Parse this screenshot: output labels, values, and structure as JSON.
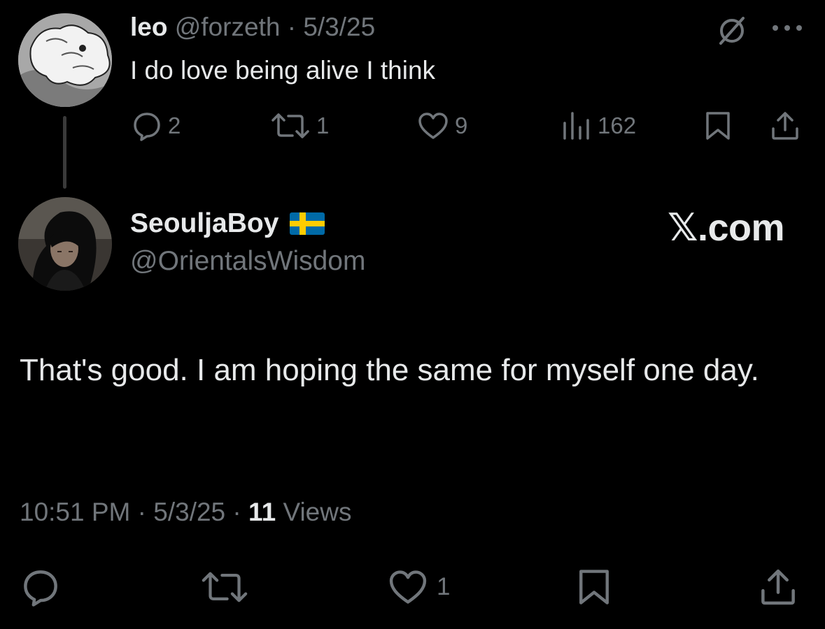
{
  "parent_tweet": {
    "name": "leo",
    "handle": "@forzeth",
    "separator": "·",
    "date": "5/3/25",
    "text": "I do love being alive I think",
    "actions": {
      "replies": "2",
      "reposts": "1",
      "likes": "9",
      "views": "162"
    }
  },
  "main_tweet": {
    "name": "SeouljaBoy",
    "flag": "sweden-flag",
    "handle": "@OrientalsWisdom",
    "text": "That's good. I am hoping the same for myself one day.",
    "time": "10:51 PM",
    "separator": "·",
    "date": "5/3/25",
    "views_count": "11",
    "views_label": "Views",
    "actions": {
      "likes": "1"
    }
  },
  "watermark": "𝕏.com",
  "colors": {
    "background": "#000000",
    "primary_text": "#e7e9ea",
    "secondary_text": "#71767b",
    "thread_line": "#3a3a3a",
    "flag_blue": "#006aa7",
    "flag_yellow": "#fecc00"
  }
}
